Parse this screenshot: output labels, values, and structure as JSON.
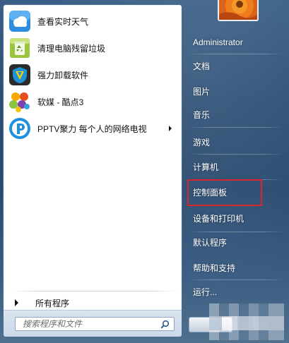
{
  "pinned_programs": [
    {
      "label": "查看实时天气",
      "icon": "weather-cloud-icon"
    },
    {
      "label": "清理电脑残留垃圾",
      "icon": "recycle-bin-icon"
    },
    {
      "label": "强力卸载软件",
      "icon": "uninstall-shield-icon"
    },
    {
      "label": "软媒 - 酷点3",
      "icon": "colorful-dots-icon"
    },
    {
      "label": "PPTV聚力 每个人的网络电视",
      "icon": "pptv-icon",
      "has_submenu": true
    }
  ],
  "all_programs_label": "所有程序",
  "search": {
    "placeholder": "搜索程序和文件"
  },
  "user": {
    "name": "Administrator"
  },
  "right_items": [
    {
      "label": "文档"
    },
    {
      "label": "图片"
    },
    {
      "label": "音乐"
    },
    {
      "label": "游戏"
    },
    {
      "label": "计算机"
    },
    {
      "label": "控制面板",
      "highlighted": true
    },
    {
      "label": "设备和打印机"
    },
    {
      "label": "默认程序"
    },
    {
      "label": "帮助和支持"
    },
    {
      "label": "运行..."
    }
  ],
  "colors": {
    "highlight": "#d8262c",
    "pane_bg": "#ffffff"
  }
}
